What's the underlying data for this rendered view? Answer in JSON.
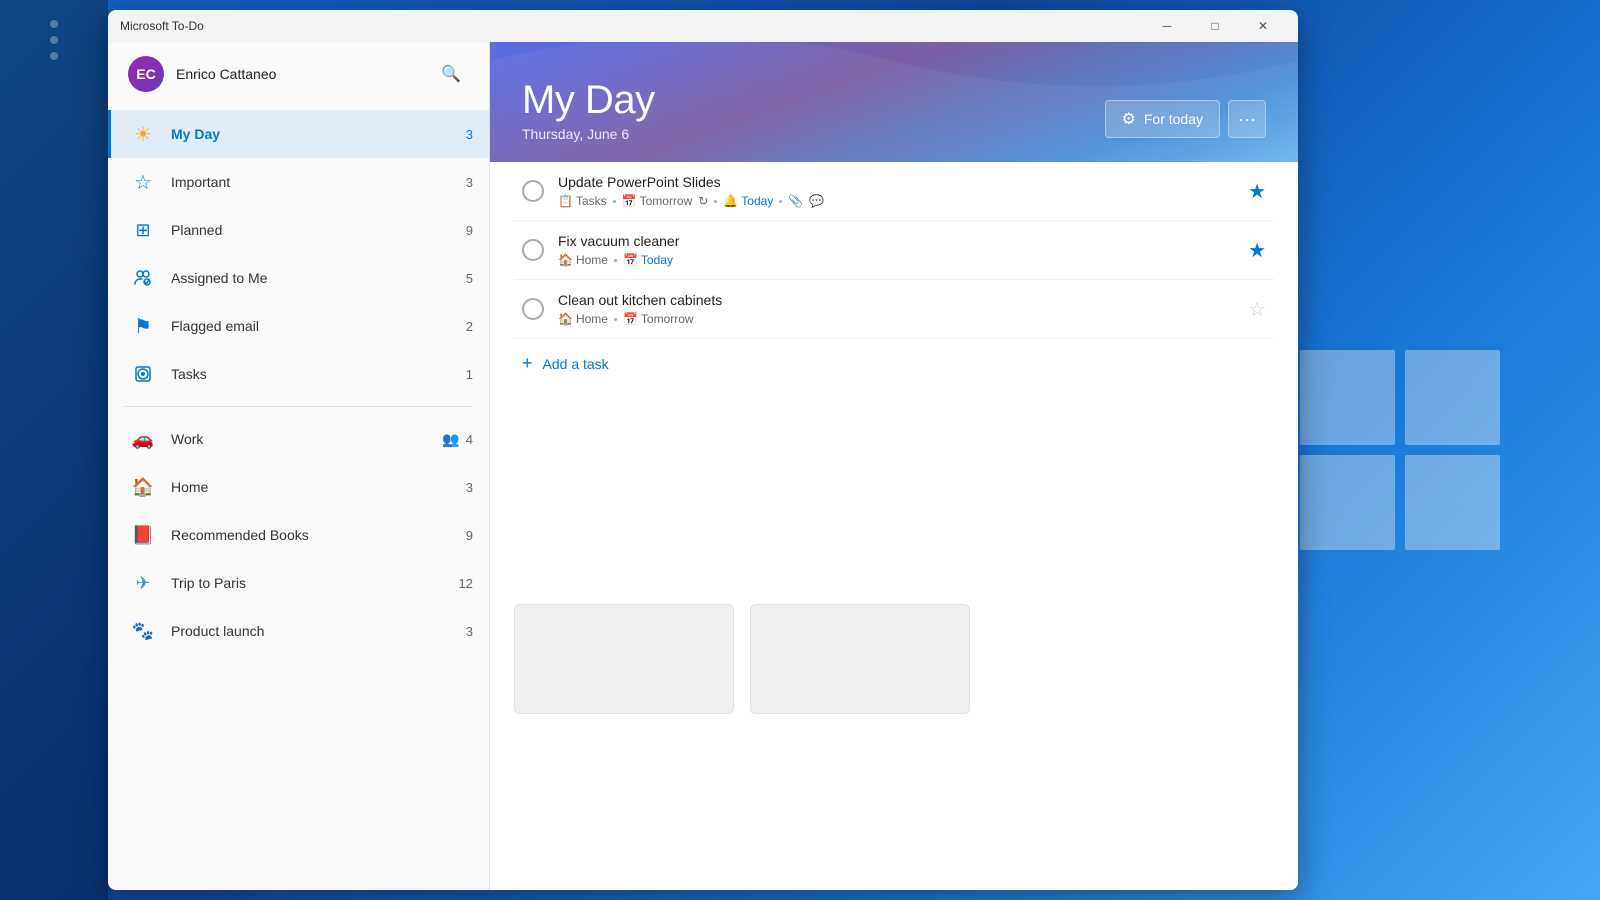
{
  "app": {
    "title": "Microsoft To-Do",
    "window_controls": {
      "minimize": "─",
      "maximize": "□",
      "close": "✕"
    }
  },
  "user": {
    "name": "Enrico Cattaneo",
    "avatar_initials": "EC"
  },
  "sidebar": {
    "nav_items": [
      {
        "id": "my-day",
        "label": "My Day",
        "icon": "☀",
        "count": "3",
        "active": true
      },
      {
        "id": "important",
        "label": "Important",
        "icon": "☆",
        "count": "3",
        "active": false
      },
      {
        "id": "planned",
        "label": "Planned",
        "icon": "▦",
        "count": "9",
        "active": false
      },
      {
        "id": "assigned",
        "label": "Assigned to Me",
        "icon": "⚡",
        "count": "5",
        "active": false
      },
      {
        "id": "flagged",
        "label": "Flagged email",
        "icon": "⚑",
        "count": "2",
        "active": false
      },
      {
        "id": "tasks",
        "label": "Tasks",
        "icon": "⊙",
        "count": "1",
        "active": false
      }
    ],
    "lists": [
      {
        "id": "work",
        "label": "Work",
        "icon": "🚗",
        "count": "4",
        "extra_icon": "👥"
      },
      {
        "id": "home",
        "label": "Home",
        "icon": "🏠",
        "count": "3"
      },
      {
        "id": "recommended-books",
        "label": "Recommended Books",
        "icon": "📕",
        "count": "9"
      },
      {
        "id": "trip-to-paris",
        "label": "Trip to Paris",
        "icon": "✈",
        "count": "12"
      },
      {
        "id": "product-launch",
        "label": "Product launch",
        "icon": "🐾",
        "count": "3"
      }
    ]
  },
  "main": {
    "title": "My Day",
    "subtitle": "Thursday, June 6",
    "for_today_label": "For today",
    "more_label": "···",
    "add_task_label": "Add a task",
    "tasks": [
      {
        "id": "task1",
        "title": "Update PowerPoint Slides",
        "meta": [
          {
            "type": "list",
            "text": "Tasks",
            "icon": "📋"
          },
          {
            "type": "due",
            "text": "Tomorrow",
            "icon": "📅"
          },
          {
            "type": "repeat",
            "icon": "🔄"
          },
          {
            "type": "reminder",
            "text": "Today",
            "icon": "🔔",
            "highlight": true
          },
          {
            "type": "notes",
            "icon": "📄"
          },
          {
            "type": "copy",
            "icon": "📋"
          }
        ],
        "starred": true
      },
      {
        "id": "task2",
        "title": "Fix vacuum cleaner",
        "meta": [
          {
            "type": "list",
            "text": "Home",
            "icon": "🏠"
          },
          {
            "type": "due",
            "text": "Today",
            "icon": "📅",
            "highlight": true
          }
        ],
        "starred": true
      },
      {
        "id": "task3",
        "title": "Clean out kitchen cabinets",
        "meta": [
          {
            "type": "list",
            "text": "Home",
            "icon": "🏠"
          },
          {
            "type": "due",
            "text": "Tomorrow",
            "icon": "📅"
          }
        ],
        "starred": false
      }
    ]
  },
  "icons": {
    "search": "🔍",
    "sun": "☀",
    "star_outline": "☆",
    "star_filled": "★",
    "calendar": "📅",
    "flag": "⚑",
    "task_circle": "○",
    "add": "+",
    "gear": "⚙",
    "dots": "···",
    "repeat": "↻",
    "bell": "🔔"
  }
}
